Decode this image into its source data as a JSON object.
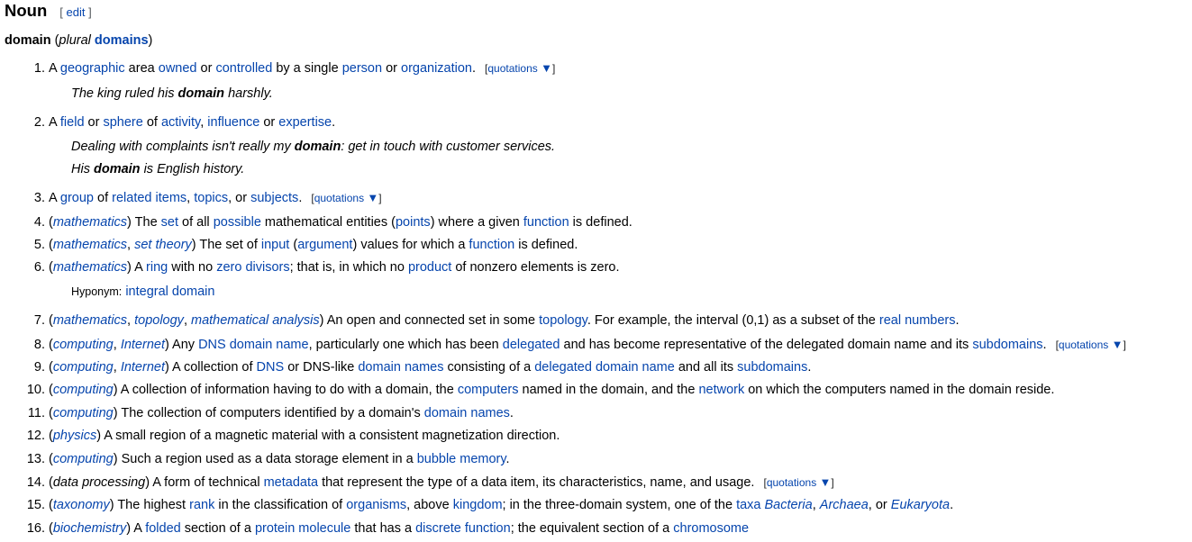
{
  "heading": {
    "title": "Noun",
    "edit_open": "[ ",
    "edit_label": "edit",
    "edit_close": " ]"
  },
  "headword": {
    "word": "domain",
    "plural_label": "plural",
    "plural_form": "domains"
  },
  "quotations_label": "quotations",
  "quotations_icon": "▼",
  "senses": [
    {
      "num": "1.",
      "parts": [
        [
          "t",
          "A "
        ],
        [
          "l",
          "geographic"
        ],
        [
          "t",
          " area "
        ],
        [
          "l",
          "owned"
        ],
        [
          "t",
          " or "
        ],
        [
          "l",
          "controlled"
        ],
        [
          "t",
          " by a single "
        ],
        [
          "l",
          "person"
        ],
        [
          "t",
          " or "
        ],
        [
          "l",
          "organization"
        ],
        [
          "t",
          "."
        ]
      ],
      "quotations": true,
      "examples": [
        [
          [
            "t",
            "The king ruled his "
          ],
          [
            "b",
            "domain"
          ],
          [
            "t",
            " harshly."
          ]
        ]
      ]
    },
    {
      "num": "2.",
      "parts": [
        [
          "t",
          "A "
        ],
        [
          "l",
          "field"
        ],
        [
          "t",
          " or "
        ],
        [
          "l",
          "sphere"
        ],
        [
          "t",
          " of "
        ],
        [
          "l",
          "activity"
        ],
        [
          "t",
          ", "
        ],
        [
          "l",
          "influence"
        ],
        [
          "t",
          " or "
        ],
        [
          "l",
          "expertise"
        ],
        [
          "t",
          "."
        ]
      ],
      "examples": [
        [
          [
            "t",
            "Dealing with complaints isn't really my "
          ],
          [
            "b",
            "domain"
          ],
          [
            "t",
            ": get in touch with customer services."
          ]
        ],
        [
          [
            "t",
            "His "
          ],
          [
            "b",
            "domain"
          ],
          [
            "t",
            " is English history."
          ]
        ]
      ]
    },
    {
      "num": "3.",
      "parts": [
        [
          "t",
          "A "
        ],
        [
          "l",
          "group"
        ],
        [
          "t",
          " of "
        ],
        [
          "l",
          "related items"
        ],
        [
          "t",
          ", "
        ],
        [
          "l",
          "topics"
        ],
        [
          "t",
          ", or "
        ],
        [
          "l",
          "subjects"
        ],
        [
          "t",
          "."
        ]
      ],
      "quotations": true
    },
    {
      "num": "4.",
      "parts": [
        [
          "t",
          "("
        ],
        [
          "li",
          "mathematics"
        ],
        [
          "t",
          ") The "
        ],
        [
          "l",
          "set"
        ],
        [
          "t",
          " of all "
        ],
        [
          "l",
          "possible"
        ],
        [
          "t",
          " mathematical entities ("
        ],
        [
          "l",
          "points"
        ],
        [
          "t",
          ") where a given "
        ],
        [
          "l",
          "function"
        ],
        [
          "t",
          " is defined."
        ]
      ]
    },
    {
      "num": "5.",
      "parts": [
        [
          "t",
          "("
        ],
        [
          "li",
          "mathematics"
        ],
        [
          "t",
          ", "
        ],
        [
          "li",
          "set theory"
        ],
        [
          "t",
          ") The set of "
        ],
        [
          "l",
          "input"
        ],
        [
          "t",
          " ("
        ],
        [
          "l",
          "argument"
        ],
        [
          "t",
          ") values for which a "
        ],
        [
          "l",
          "function"
        ],
        [
          "t",
          " is defined."
        ]
      ]
    },
    {
      "num": "6.",
      "parts": [
        [
          "t",
          "("
        ],
        [
          "li",
          "mathematics"
        ],
        [
          "t",
          ") A "
        ],
        [
          "l",
          "ring"
        ],
        [
          "t",
          " with no "
        ],
        [
          "l",
          "zero divisors"
        ],
        [
          "t",
          "; that is, in which no "
        ],
        [
          "l",
          "product"
        ],
        [
          "t",
          " of nonzero elements is zero."
        ]
      ],
      "hyponym": {
        "label": "Hyponym:",
        "term": "integral domain"
      }
    },
    {
      "num": "7.",
      "parts": [
        [
          "t",
          "("
        ],
        [
          "li",
          "mathematics"
        ],
        [
          "t",
          ", "
        ],
        [
          "li",
          "topology"
        ],
        [
          "t",
          ", "
        ],
        [
          "li",
          "mathematical analysis"
        ],
        [
          "t",
          ") An open and connected set in some "
        ],
        [
          "l",
          "topology"
        ],
        [
          "t",
          ". For example, the interval (0,1) as a subset of the "
        ],
        [
          "l",
          "real numbers"
        ],
        [
          "t",
          "."
        ]
      ]
    },
    {
      "num": "8.",
      "parts": [
        [
          "t",
          "("
        ],
        [
          "li",
          "computing"
        ],
        [
          "t",
          ", "
        ],
        [
          "li",
          "Internet"
        ],
        [
          "t",
          ") Any "
        ],
        [
          "l",
          "DNS domain name"
        ],
        [
          "t",
          ", particularly one which has been "
        ],
        [
          "l",
          "delegated"
        ],
        [
          "t",
          " and has become representative of the delegated domain name and its "
        ],
        [
          "l",
          "subdomains"
        ],
        [
          "t",
          "."
        ]
      ],
      "quotations": true
    },
    {
      "num": "9.",
      "parts": [
        [
          "t",
          "("
        ],
        [
          "li",
          "computing"
        ],
        [
          "t",
          ", "
        ],
        [
          "li",
          "Internet"
        ],
        [
          "t",
          ") A collection of "
        ],
        [
          "l",
          "DNS"
        ],
        [
          "t",
          " or DNS-like "
        ],
        [
          "l",
          "domain names"
        ],
        [
          "t",
          " consisting of a "
        ],
        [
          "l",
          "delegated domain name"
        ],
        [
          "t",
          " and all its "
        ],
        [
          "l",
          "subdomains"
        ],
        [
          "t",
          "."
        ]
      ]
    },
    {
      "num": "10.",
      "parts": [
        [
          "t",
          "("
        ],
        [
          "li",
          "computing"
        ],
        [
          "t",
          ") A collection of information having to do with a domain, the "
        ],
        [
          "l",
          "computers"
        ],
        [
          "t",
          " named in the domain, and the "
        ],
        [
          "l",
          "network"
        ],
        [
          "t",
          " on which the computers named in the domain reside."
        ]
      ]
    },
    {
      "num": "11.",
      "parts": [
        [
          "t",
          "("
        ],
        [
          "li",
          "computing"
        ],
        [
          "t",
          ") The collection of computers identified by a domain's "
        ],
        [
          "l",
          "domain names"
        ],
        [
          "t",
          "."
        ]
      ]
    },
    {
      "num": "12.",
      "parts": [
        [
          "t",
          "("
        ],
        [
          "li",
          "physics"
        ],
        [
          "t",
          ") A small region of a magnetic material with a consistent magnetization direction."
        ]
      ]
    },
    {
      "num": "13.",
      "parts": [
        [
          "t",
          "("
        ],
        [
          "li",
          "computing"
        ],
        [
          "t",
          ") Such a region used as a data storage element in a "
        ],
        [
          "l",
          "bubble memory"
        ],
        [
          "t",
          "."
        ]
      ]
    },
    {
      "num": "14.",
      "parts": [
        [
          "t",
          "("
        ],
        [
          "i",
          "data processing"
        ],
        [
          "t",
          ") A form of technical "
        ],
        [
          "l",
          "metadata"
        ],
        [
          "t",
          " that represent the type of a data item, its characteristics, name, and usage."
        ]
      ],
      "quotations": true
    },
    {
      "num": "15.",
      "parts": [
        [
          "t",
          "("
        ],
        [
          "li",
          "taxonomy"
        ],
        [
          "t",
          ") The highest "
        ],
        [
          "l",
          "rank"
        ],
        [
          "t",
          " in the classification of "
        ],
        [
          "l",
          "organisms"
        ],
        [
          "t",
          ", above "
        ],
        [
          "l",
          "kingdom"
        ],
        [
          "t",
          "; in the three-domain system, one of the "
        ],
        [
          "l",
          "taxa"
        ],
        [
          "t",
          " "
        ],
        [
          "li",
          "Bacteria"
        ],
        [
          "t",
          ", "
        ],
        [
          "li",
          "Archaea"
        ],
        [
          "t",
          ", or "
        ],
        [
          "li",
          "Eukaryota"
        ],
        [
          "t",
          "."
        ]
      ]
    },
    {
      "num": "16.",
      "parts": [
        [
          "t",
          "("
        ],
        [
          "li",
          "biochemistry"
        ],
        [
          "t",
          ") A "
        ],
        [
          "l",
          "folded"
        ],
        [
          "t",
          " section of a "
        ],
        [
          "l",
          "protein molecule"
        ],
        [
          "t",
          " that has a "
        ],
        [
          "l",
          "discrete function"
        ],
        [
          "t",
          "; the equivalent section of a "
        ],
        [
          "l",
          "chromosome"
        ]
      ]
    }
  ]
}
